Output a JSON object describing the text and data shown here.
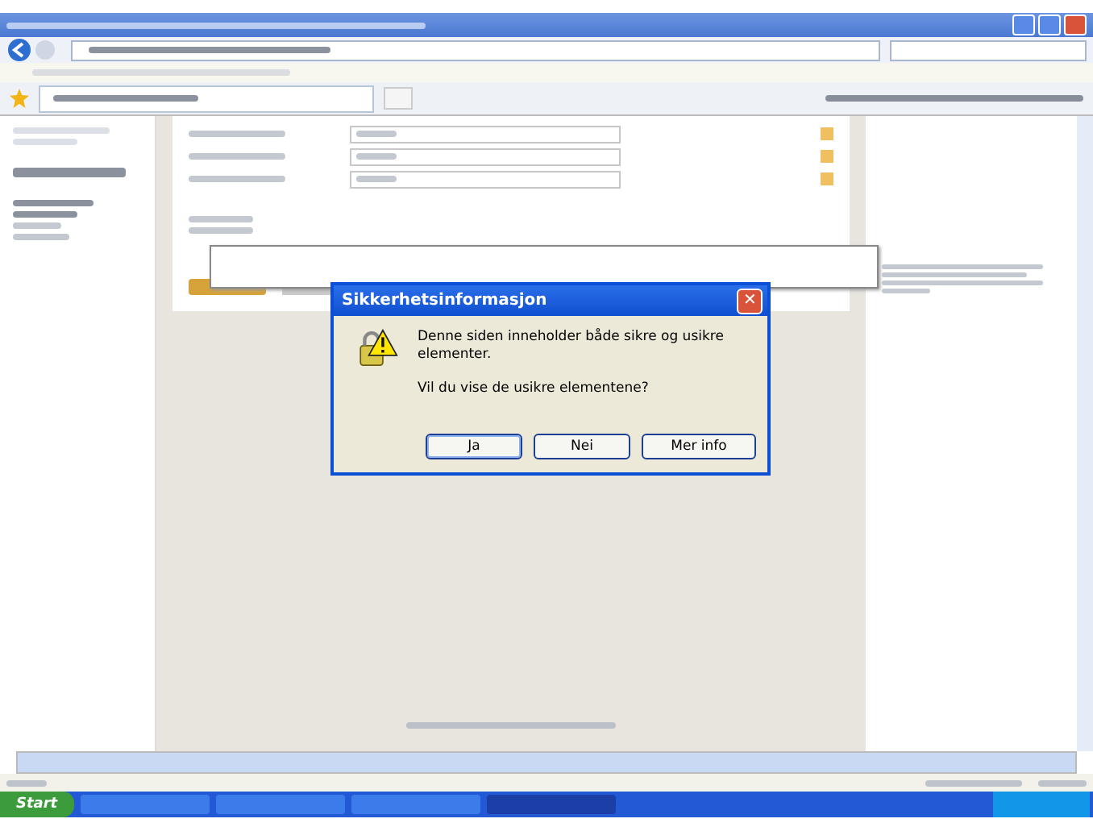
{
  "dialog": {
    "title": "Sikkerhetsinformasjon",
    "close": "✕",
    "message": "Denne siden inneholder både sikre og usikre elementer.",
    "question": "Vil du vise de usikre elementene?",
    "buttons": [
      {
        "label": "Ja",
        "selected": true
      },
      {
        "label": "Nei",
        "selected": false
      },
      {
        "label": "Mer info",
        "selected": false
      }
    ]
  },
  "taskbar": {
    "start": "Start"
  }
}
